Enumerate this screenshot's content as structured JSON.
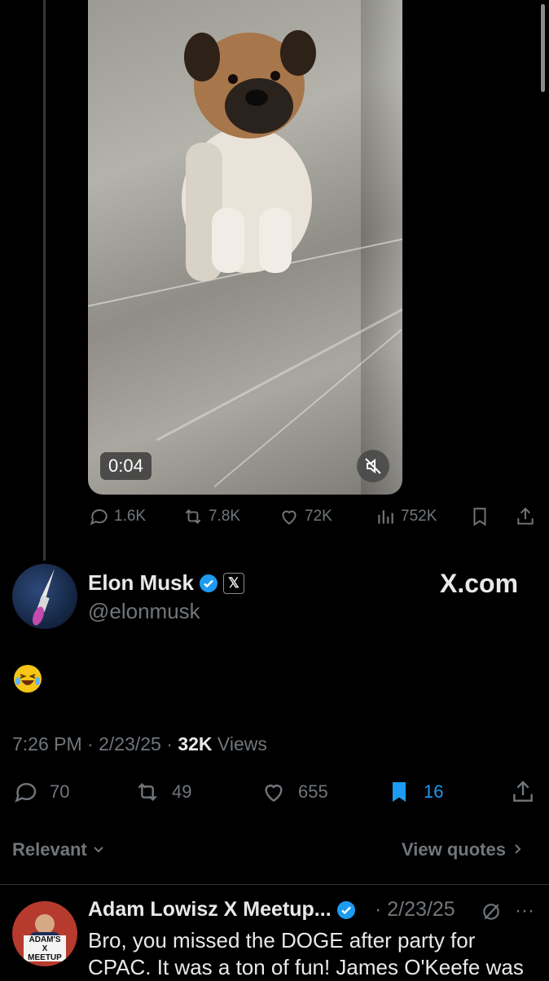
{
  "media": {
    "duration": "0:04"
  },
  "embedded_stats": {
    "replies": "1.6K",
    "reposts": "7.8K",
    "likes": "72K",
    "views": "752K"
  },
  "author": {
    "name": "Elon Musk",
    "handle": "@elonmusk",
    "affiliation": "X.com",
    "badge_color": "#1d9bf0"
  },
  "post": {
    "text_emoji": "😂",
    "time": "7:26 PM",
    "date": "2/23/25",
    "views_count": "32K",
    "views_label": "Views"
  },
  "actions": {
    "replies": "70",
    "reposts": "49",
    "likes": "655",
    "bookmarks": "16",
    "bookmark_color": "#1d9bf0"
  },
  "sort": {
    "label": "Relevant",
    "view_quotes": "View quotes"
  },
  "reply": {
    "name": "Adam Lowisz X Meetup...",
    "date": "2/23/25",
    "avatar_text": "ADAM'S X MEETUP",
    "text": "Bro, you missed the DOGE after party for CPAC. It was a ton of fun! James O'Keefe was"
  }
}
